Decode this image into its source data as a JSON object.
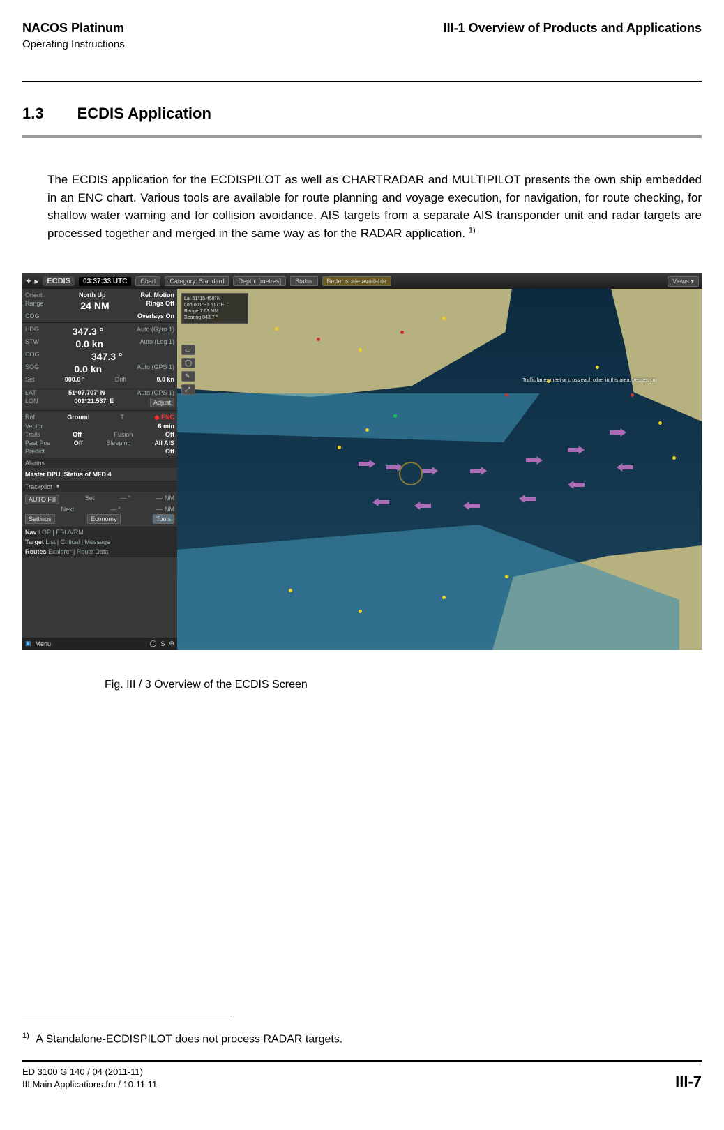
{
  "header": {
    "title": "NACOS Platinum",
    "subtitle": "Operating Instructions",
    "chapter": "III-1  Overview of Products and Applications"
  },
  "section": {
    "number": "1.3",
    "title": "ECDIS Application"
  },
  "paragraph": "The ECDIS application for the ECDISPILOT as well as CHARTRADAR and MULTIPILOT presents the own ship embedded in an ENC chart. Various tools are available for route planning and voyage execution, for navigation, for route checking, for shallow water warning and for collision avoidance. AIS targets from a separate AIS transponder unit and radar targets are processed together and merged in the same way as for the RADAR application.",
  "paragraph_sup": "1)",
  "caption": "Fig. III /  3   Overview of the ECDIS Screen",
  "footnote": {
    "mark": "1)",
    "text": "A Standalone-ECDISPILOT does not process RADAR targets."
  },
  "footer": {
    "line1": "ED 3100 G 140 / 04 (2011-11)",
    "line2": "III Main Applications.fm / 10.11.11",
    "page": "III-7"
  },
  "screenshot": {
    "topbar": {
      "app_label": "ECDIS",
      "time": "03:37:33 UTC",
      "chips": [
        "Chart",
        "Category: Standard",
        "Depth: [metres]",
        "Status"
      ],
      "warn": "Better scale available",
      "views": "Views"
    },
    "display": {
      "orient": "North Up",
      "range": "24 NM",
      "cog_mode": "Rel. Motion",
      "rings": "Rings Off",
      "overlays": "Overlays On"
    },
    "nav": {
      "hdg_lbl": "HDG",
      "hdg_val": "347.3 °",
      "hdg_src": "Auto (Gyro 1)",
      "stw_lbl": "STW",
      "stw_val": "0.0 kn",
      "stw_src": "Auto (Log 1)",
      "cog_lbl": "COG",
      "cog_val": "347.3 °",
      "sog_lbl": "SOG",
      "sog_val": "0.0 kn",
      "sog_src": "Auto (GPS 1)",
      "set_lbl": "Set",
      "set_val": "000.0 °",
      "drift_lbl": "Drift",
      "drift_val": "0.0  kn"
    },
    "pos": {
      "lat_lbl": "LAT",
      "lat_val": "51°07.707' N",
      "lat_src": "Auto (GPS 1)",
      "lon_lbl": "LON",
      "lon_val": "001°21.537' E",
      "adjust": "Adjust"
    },
    "vector": {
      "ref_lbl": "Ref.",
      "ref_val": "Ground",
      "t_lbl": "T",
      "enc": "ENC",
      "time_lbl": "Vector",
      "time_val": "6 min",
      "trails_lbl": "Trails",
      "trails_val": "Off",
      "fusion_lbl": "Fusion",
      "fusion_val": "Off",
      "pastpos_lbl": "Past Pos",
      "pastpos_val": "Off",
      "sleeping_lbl": "Sleeping",
      "sleeping_val": "All AIS",
      "predict_lbl": "Predict",
      "predict_val": "Off"
    },
    "alarms_title": "Alarms",
    "mfd_status": "Master DPU. Status of MFD 4",
    "trackpilot": {
      "title": "Trackpilot",
      "auto_fill": "AUTO Fill",
      "set": "Set",
      "next": "Next",
      "nm1": "NM",
      "nm2": "NM",
      "settings": "Settings",
      "economy": "Economy",
      "tools": "Tools"
    },
    "bottom_tabs": {
      "nav": "Nav",
      "target": "Target",
      "routes": "Routes",
      "nav_sub": "LOP | EBL/VRM",
      "target_sub": "List | Critical | Message",
      "routes_sub": "Explorer | Route Data"
    },
    "menu": "Menu",
    "chart_labels": {
      "traffic": "Traffic lanes meet or cross each other in this area. Vessels cu"
    }
  }
}
